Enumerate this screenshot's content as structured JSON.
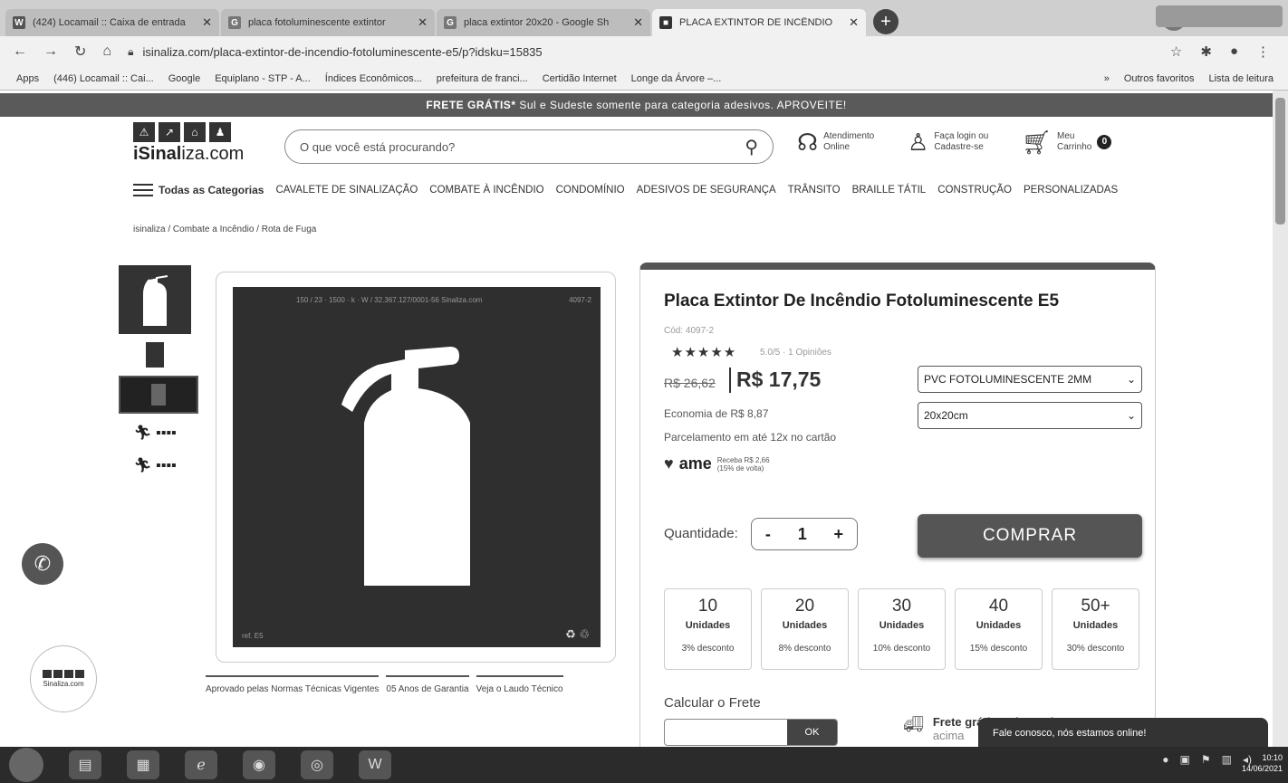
{
  "browser": {
    "tabs": [
      {
        "favicon": "W",
        "title": "(424) Locamail :: Caixa de entrada",
        "active": false
      },
      {
        "favicon": "G",
        "title": "placa fotoluminescente extintor",
        "active": false
      },
      {
        "favicon": "G",
        "title": "placa extintor 20x20 - Google Sh",
        "active": false
      },
      {
        "favicon": "■",
        "title": "PLACA EXTINTOR DE INCÊNDIO",
        "active": true
      }
    ],
    "new_tab": "+",
    "url": "isinaliza.com/placa-extintor-de-incendio-fotoluminescente-e5/p?idsku=15835",
    "bookmarks": [
      "Apps",
      "(446) Locamail :: Cai...",
      "Google",
      "Equiplano - STP - A...",
      "Índices Econômicos...",
      "prefeitura de franci...",
      "Certidão Internet",
      "Longe da Árvore –..."
    ],
    "bookmarks_more": "»",
    "other_favorites": "Outros favoritos",
    "reading_list": "Lista de leitura"
  },
  "promo": {
    "bold": "FRETE GRÁTIS*",
    "rest": "Sul e Sudeste somente para categoria adesivos. APROVEITE!"
  },
  "header": {
    "logo_blocks": [
      "⚠",
      "↗",
      "⌂",
      "♟"
    ],
    "logo_bold": "iSinal",
    "logo_rest": "iza.com",
    "search_placeholder": "O que você está procurando?",
    "support_line1": "Atendimento",
    "support_line2": "Online",
    "login_line1": "Faça login ou",
    "login_line2": "Cadastre-se",
    "cart_line1": "Meu",
    "cart_line2": "Carrinho",
    "cart_count": "0"
  },
  "nav": {
    "all": "Todas as Categorias",
    "items": [
      "CAVALETE DE SINALIZAÇÃO",
      "COMBATE À INCÊNDIO",
      "CONDOMÍNIO",
      "ADESIVOS DE SEGURANÇA",
      "TRÂNSITO",
      "BRAILLE TÁTIL",
      "CONSTRUÇÃO",
      "PERSONALIZADAS"
    ]
  },
  "breadcrumb": "isinaliza  /  Combate a Incêndio  /  Rota de Fuga",
  "image": {
    "top_code": "150 / 23 · 1500 · k · W / 32.367.127/0001-56 Sinaliza.com",
    "code_right": "4097-2",
    "ref": "ref. E5"
  },
  "features": [
    "Aprovado pelas Normas Técnicas Vigentes",
    "05 Anos de Garantia",
    "Veja o Laudo Técnico"
  ],
  "product": {
    "title": "Placa Extintor De Incêndio Fotoluminescente E5",
    "code": "Cód: 4097-2",
    "stars": "★★★★★",
    "rating": "5.0/5 · 1 Opiniões",
    "old_price": "R$ 26,62",
    "price": "R$ 17,75",
    "economy": "Economia de R$ 8,87",
    "installments": "Parcelamento em até 12x no cartão",
    "ame_logo": "ame",
    "ame_cashback": "Receba R$ 2,66",
    "ame_percent": "(15% de volta)",
    "material": "PVC FOTOLUMINESCENTE 2MM",
    "size": "20x20cm",
    "qty_label": "Quantidade:",
    "qty_minus": "-",
    "qty_value": "1",
    "qty_plus": "+",
    "buy": "COMPRAR",
    "discounts": [
      {
        "qty": "10",
        "unit": "Unidades",
        "pct": "3% desconto"
      },
      {
        "qty": "20",
        "unit": "Unidades",
        "pct": "8% desconto"
      },
      {
        "qty": "30",
        "unit": "Unidades",
        "pct": "10% desconto"
      },
      {
        "qty": "40",
        "unit": "Unidades",
        "pct": "15% desconto"
      },
      {
        "qty": "50+",
        "unit": "Unidades",
        "pct": "30% desconto"
      }
    ],
    "freight_label": "Calcular o Frete",
    "ok": "OK",
    "free_title": "Frete grátis Sul e Sudeste",
    "free_sub": "acima"
  },
  "chat": "Fale conosco, nós estamos online!",
  "corner_logo": "Sinaliza.com",
  "clock": {
    "time": "10:10",
    "date": "14/06/2021"
  }
}
